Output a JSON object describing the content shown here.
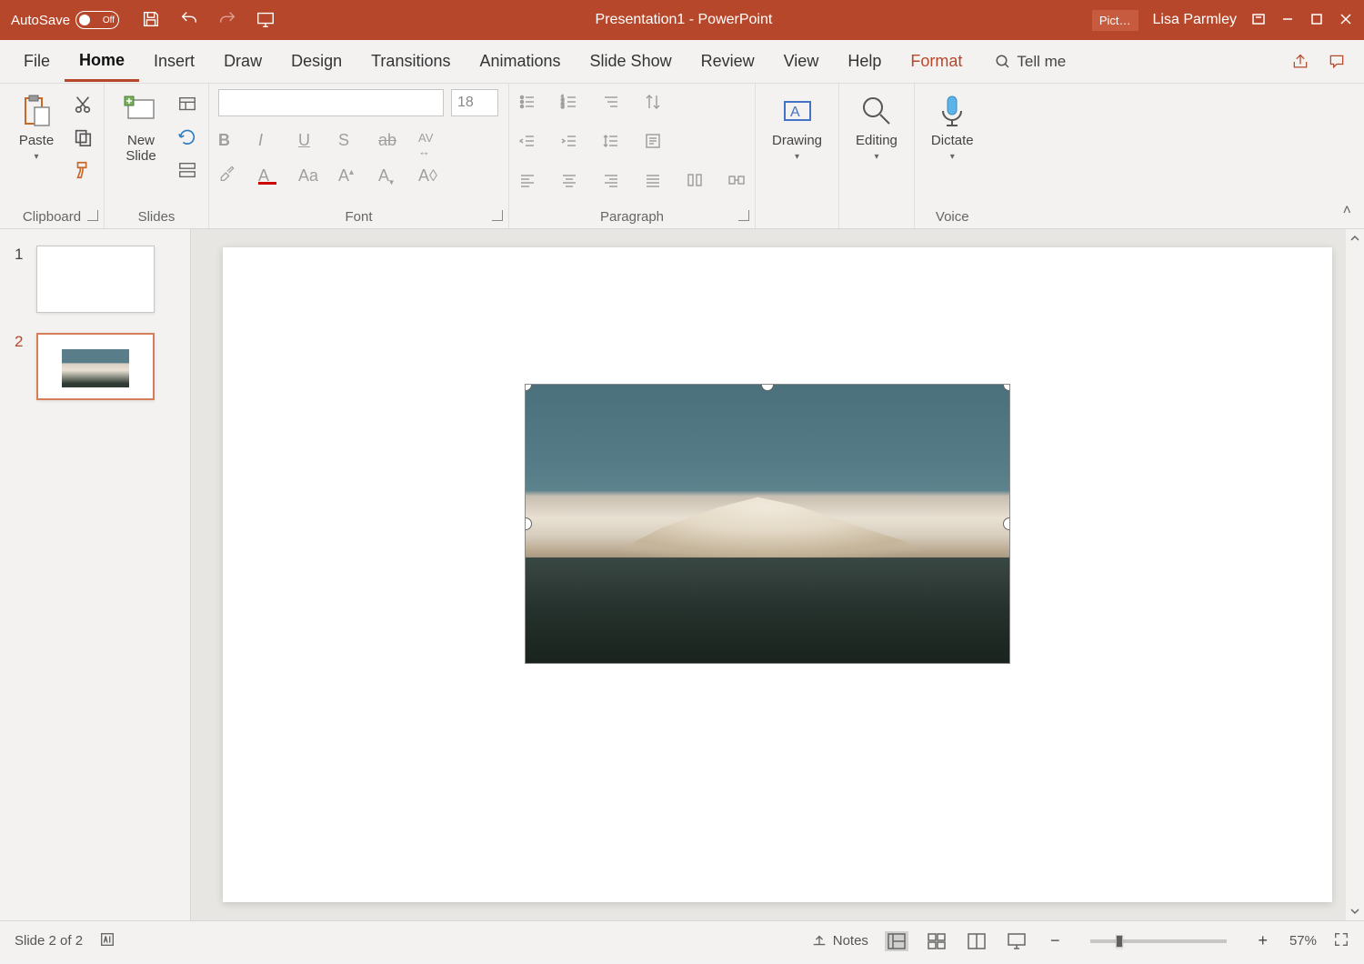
{
  "titlebar": {
    "autosave_label": "AutoSave",
    "autosave_state": "Off",
    "doc_title": "Presentation1  -  PowerPoint",
    "context_tab": "Pict…",
    "username": "Lisa Parmley"
  },
  "tabs": {
    "file": "File",
    "home": "Home",
    "insert": "Insert",
    "draw": "Draw",
    "design": "Design",
    "transitions": "Transitions",
    "animations": "Animations",
    "slideshow": "Slide Show",
    "review": "Review",
    "view": "View",
    "help": "Help",
    "format": "Format",
    "tellme": "Tell me"
  },
  "ribbon": {
    "clipboard": {
      "paste": "Paste",
      "label": "Clipboard"
    },
    "slides": {
      "new_slide": "New\nSlide",
      "label": "Slides"
    },
    "font": {
      "size": "18",
      "label": "Font"
    },
    "paragraph": {
      "label": "Paragraph"
    },
    "drawing": {
      "btn": "Drawing",
      "label": ""
    },
    "editing": {
      "btn": "Editing",
      "label": ""
    },
    "voice": {
      "btn": "Dictate",
      "label": "Voice"
    }
  },
  "thumbs": {
    "n1": "1",
    "n2": "2"
  },
  "status": {
    "slide_pos": "Slide 2 of 2",
    "notes": "Notes",
    "zoom": "57%"
  }
}
